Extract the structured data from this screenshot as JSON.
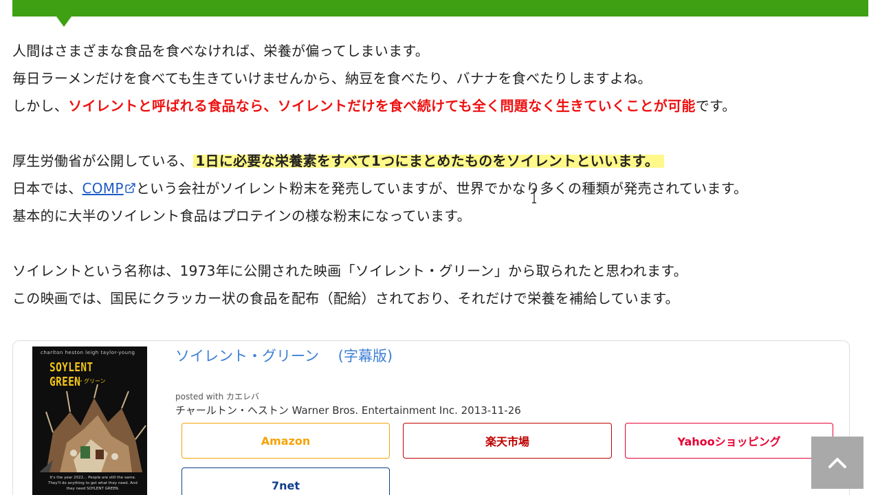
{
  "article": {
    "p1": {
      "line1": "人間はさまざまな食品を食べなければ、栄養が偏ってしまいます。",
      "line2": "毎日ラーメンだけを食べても生きていけませんから、納豆を食べたり、バナナを食べたりしますよね。",
      "line3_pre": "しかし、",
      "line3_emphasis": "ソイレントと呼ばれる食品なら、ソイレントだけを食べ続けても全く問題なく生きていくことが可能",
      "line3_post": "です。"
    },
    "p2": {
      "line1_pre": "厚生労働省が公開している、",
      "line1_marker": "1日に必要な栄養素をすべて1つにまとめたものをソイレントといいます。",
      "line2_pre": "日本では、",
      "line2_link": "COMP",
      "line2_post": "という会社がソイレント粉末を発売していますが、世界でかなり多くの種類が発売されています。",
      "line3": "基本的に大半のソイレント食品はプロテインの様な粉末になっています。"
    },
    "p3": {
      "line1": "ソイレントという名称は、1973年に公開された映画「ソイレント・グリーン」から取られたと思われます。",
      "line2": "この映画では、国民にクラッカー状の食品を配布（配給）されており、それだけで栄養を補給しています。"
    }
  },
  "product_card": {
    "poster": {
      "credits": "charlton heston    leigh taylor-young",
      "title": "SOYLENT GREEN",
      "subtitle": "ソイレント・グリーン",
      "tagline": "It's the year 2022... People are still the same. They'll do anything to get what they need. And they need SOYLENT GREEN."
    },
    "title": "ソイレント・グリーン　 (字幕版)",
    "posted_with": "posted with カエレバ",
    "info": "チャールトン・ヘストン Warner Bros. Entertainment Inc. 2013-11-26",
    "buttons": {
      "amazon": "Amazon",
      "rakuten": "楽天市場",
      "yahoo": "Yahooショッピング",
      "sevennet": "7net"
    }
  },
  "colors": {
    "heading_green": "#3fa013",
    "emphasis_red": "#ee1111",
    "marker_yellow": "#fff88a",
    "link_blue": "#1d5cc6",
    "amazon": "#f6a306",
    "rakuten": "#bf0000",
    "yahoo": "#e60033",
    "sevennet": "#0f3e8c"
  },
  "icons": {
    "external_link": "external-link-icon",
    "back_to_top": "chevron-up-icon",
    "text_cursor": "text-cursor-icon"
  }
}
